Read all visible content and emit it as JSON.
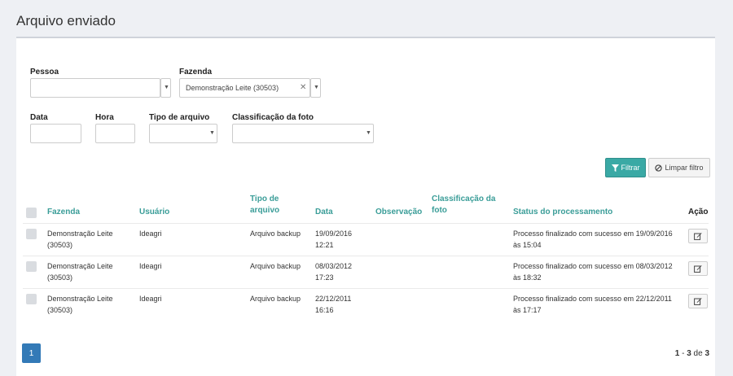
{
  "page": {
    "title": "Arquivo enviado"
  },
  "filters": {
    "pessoa": {
      "label": "Pessoa",
      "value": ""
    },
    "fazenda": {
      "label": "Fazenda",
      "value": "Demonstração Leite (30503)"
    },
    "data": {
      "label": "Data",
      "value": ""
    },
    "hora": {
      "label": "Hora",
      "value": ""
    },
    "tipo": {
      "label": "Tipo de arquivo",
      "value": ""
    },
    "classificacao": {
      "label": "Classificação da foto",
      "value": ""
    }
  },
  "buttons": {
    "filter": "Filtrar",
    "clear": "Limpar filtro"
  },
  "table": {
    "headers": {
      "fazenda": "Fazenda",
      "usuario": "Usuário",
      "tipo_1": "Tipo de",
      "tipo_2": "arquivo",
      "data": "Data",
      "observacao": "Observação",
      "classificacao_1": "Classificação da",
      "classificacao_2": "foto",
      "status": "Status do processamento",
      "acao": "Ação"
    },
    "rows": [
      {
        "fazenda_1": "Demonstração Leite",
        "fazenda_2": "(30503)",
        "usuario": "Ideagri",
        "tipo": "Arquivo backup",
        "data": "19/09/2016",
        "hora": "12:21",
        "observacao": "",
        "classificacao": "",
        "status_1": "Processo finalizado com sucesso em 19/09/2016",
        "status_2": "às 15:04"
      },
      {
        "fazenda_1": "Demonstração Leite",
        "fazenda_2": "(30503)",
        "usuario": "Ideagri",
        "tipo": "Arquivo backup",
        "data": "08/03/2012",
        "hora": "17:23",
        "observacao": "",
        "classificacao": "",
        "status_1": "Processo finalizado com sucesso em 08/03/2012",
        "status_2": "às 18:32"
      },
      {
        "fazenda_1": "Demonstração Leite",
        "fazenda_2": "(30503)",
        "usuario": "Ideagri",
        "tipo": "Arquivo backup",
        "data": "22/12/2011",
        "hora": "16:16",
        "observacao": "",
        "classificacao": "",
        "status_1": "Processo finalizado com sucesso em 22/12/2011",
        "status_2": "às 17:17"
      }
    ]
  },
  "pagination": {
    "current_page": "1",
    "from": "1",
    "to": "3",
    "sep": "-",
    "of_word": "de",
    "total": "3"
  },
  "colors": {
    "accent": "#3aa9a5",
    "header_text": "#3a9d98",
    "page_button": "#337ab7"
  },
  "icons": {
    "filter": "filter-icon",
    "clear": "ban-icon",
    "edit": "edit-icon"
  }
}
